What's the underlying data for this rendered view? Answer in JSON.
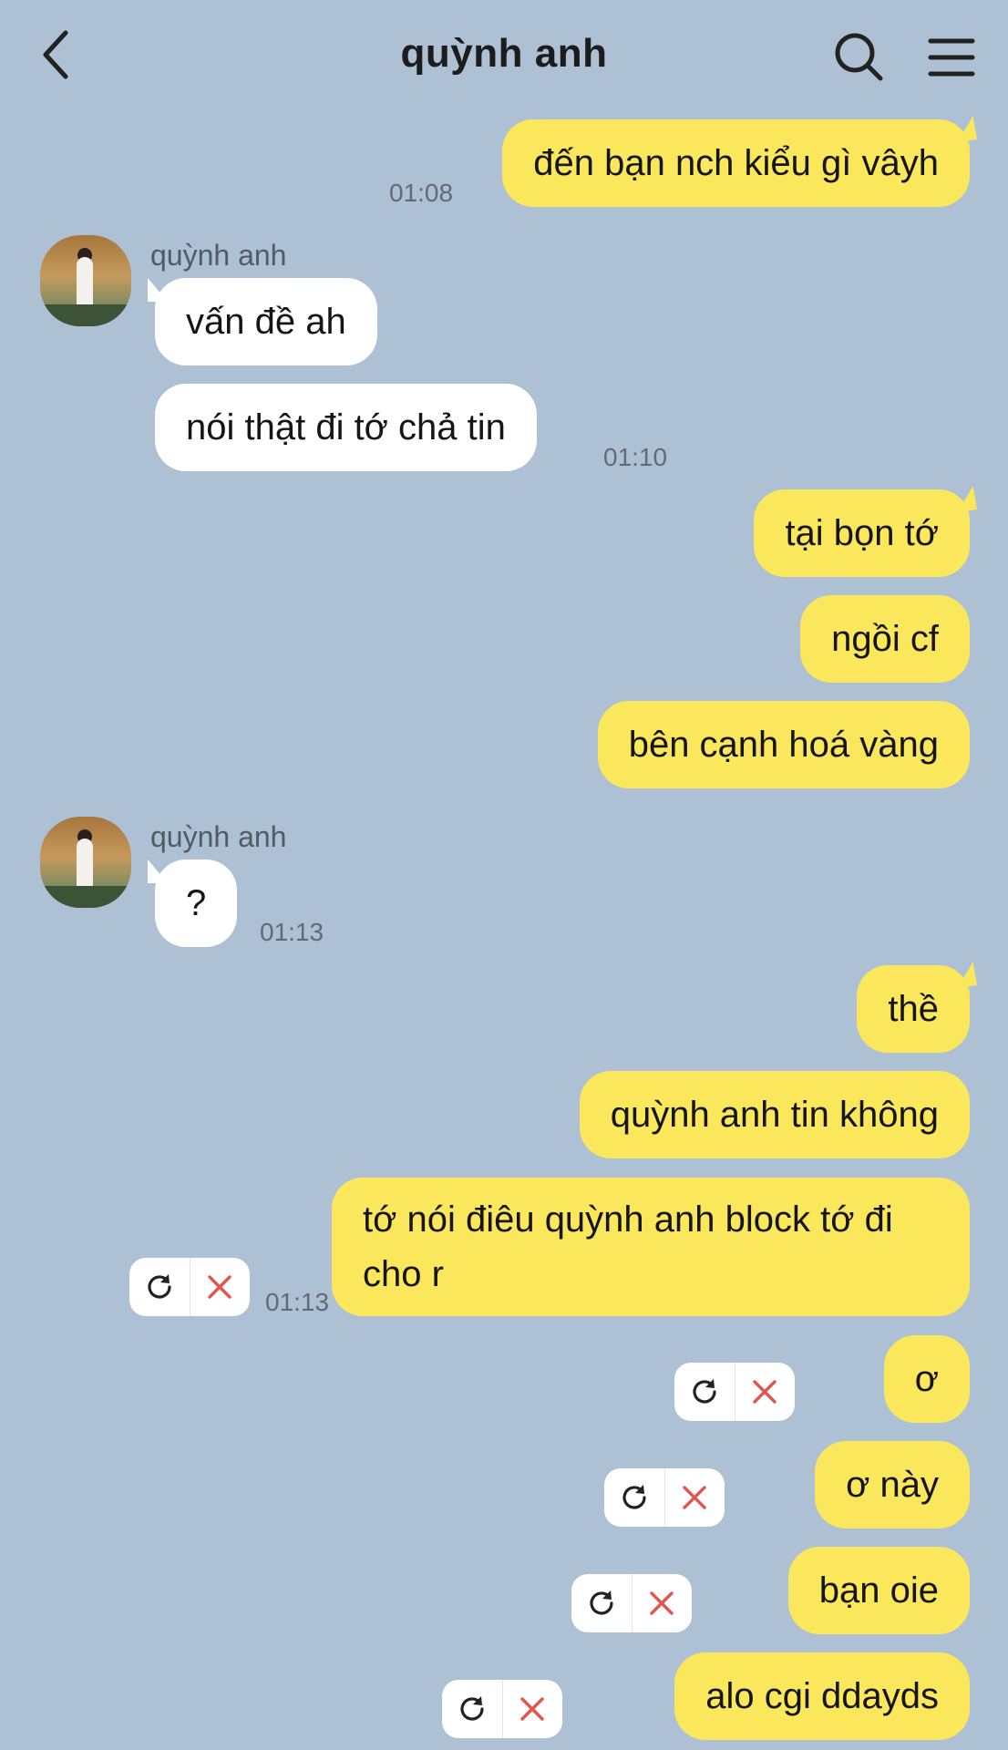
{
  "header": {
    "title": "quỳnh anh"
  },
  "icons": {
    "back": "chevron-left-icon",
    "search": "search-icon",
    "menu": "hamburger-menu-icon",
    "retry": "refresh-icon",
    "delete": "close-icon"
  },
  "colors": {
    "background": "#aec0d3",
    "outgoing_bubble": "#fbe75c",
    "incoming_bubble": "#ffffff",
    "delete_icon": "#e5534b"
  },
  "messages": [
    {
      "side": "me",
      "text": "đến bạn nch kiểu gì vâyh",
      "time": "01:08"
    },
    {
      "side": "them",
      "sender": "quỳnh anh",
      "text": "vấn đề ah"
    },
    {
      "side": "them",
      "text": "nói thật đi tớ chả tin",
      "time": "01:10"
    },
    {
      "side": "me",
      "text": "tại bọn tớ"
    },
    {
      "side": "me",
      "text": "ngồi cf"
    },
    {
      "side": "me",
      "text": "bên cạnh hoá vàng"
    },
    {
      "side": "them",
      "sender": "quỳnh anh",
      "text": "?",
      "time": "01:13"
    },
    {
      "side": "me",
      "text": "thề"
    },
    {
      "side": "me",
      "text": "quỳnh anh tin không"
    },
    {
      "side": "me",
      "text": "tớ nói điêu quỳnh anh block tớ đi cho r",
      "time": "01:13",
      "failed": true
    },
    {
      "side": "me",
      "text": "ơ",
      "failed": true
    },
    {
      "side": "me",
      "text": "ơ này",
      "failed": true
    },
    {
      "side": "me",
      "text": "bạn oie",
      "failed": true
    },
    {
      "side": "me",
      "text": "alo cgi ddayds",
      "failed": true
    }
  ]
}
